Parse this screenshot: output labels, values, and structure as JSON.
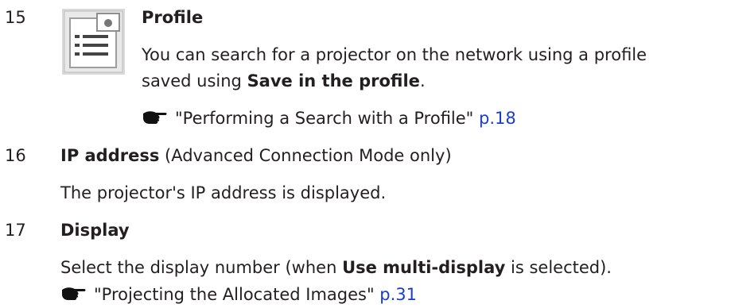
{
  "items": [
    {
      "number": "15",
      "title": "Profile",
      "icon": "profile-list-icon",
      "desc_pre": "You can search for a projector on the network using a profile",
      "desc_line2_pre": "saved using ",
      "desc_bold": "Save in the profile",
      "desc_post": ".",
      "ref_text": "\"Performing a Search with a Profile\" ",
      "ref_page": "p.18"
    },
    {
      "number": "16",
      "title": "IP address",
      "title_suffix": " (Advanced Connection Mode only)",
      "desc": "The projector's IP address is displayed."
    },
    {
      "number": "17",
      "title": "Display",
      "desc_pre": "Select the display number (when ",
      "desc_bold": "Use multi-display",
      "desc_post": " is selected).",
      "ref_text": "\"Projecting the Allocated Images\" ",
      "ref_page": "p.31"
    }
  ],
  "colors": {
    "text": "#231f20",
    "link": "#1a3ccf"
  }
}
